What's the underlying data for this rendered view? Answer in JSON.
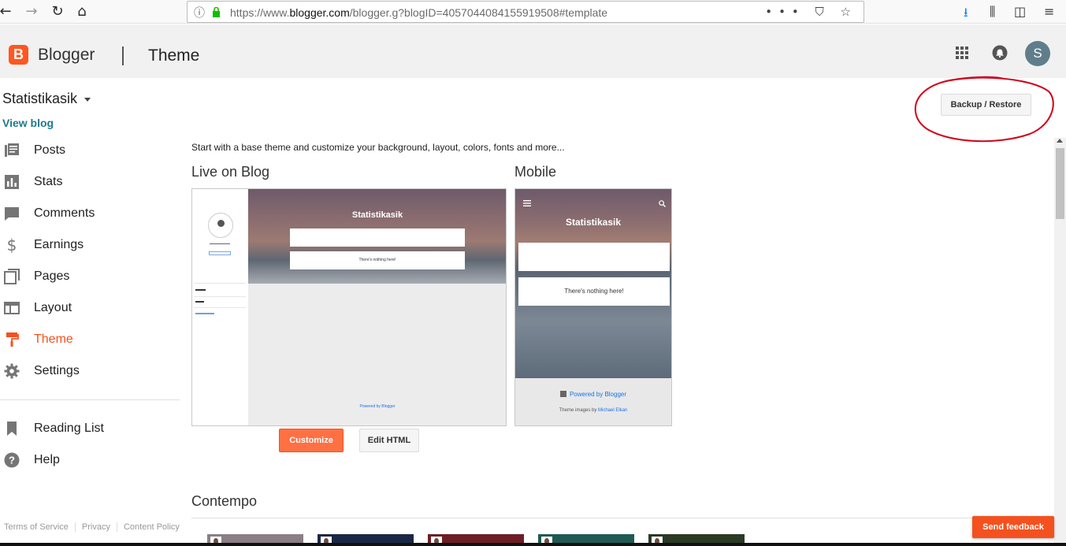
{
  "browser": {
    "url_prefix": "https://www.",
    "url_domain": "blogger.com",
    "url_rest": "/blogger.g?blogID=4057044084155919508#template",
    "page_actions": "••• ⛉ ☆"
  },
  "appbar": {
    "brand": "Blogger",
    "section": "Theme",
    "avatar_letter": "S"
  },
  "sidebar": {
    "blog_name": "Statistikasik",
    "view_blog": "View blog",
    "items": [
      {
        "label": "Posts",
        "icon": "posts-icon"
      },
      {
        "label": "Stats",
        "icon": "stats-icon"
      },
      {
        "label": "Comments",
        "icon": "comments-icon"
      },
      {
        "label": "Earnings",
        "icon": "dollar-icon"
      },
      {
        "label": "Pages",
        "icon": "pages-icon"
      },
      {
        "label": "Layout",
        "icon": "layout-icon"
      },
      {
        "label": "Theme",
        "icon": "paint-roller-icon",
        "active": true
      },
      {
        "label": "Settings",
        "icon": "gear-icon"
      }
    ],
    "secondary_items": [
      {
        "label": "Reading List",
        "icon": "bookmark-icon"
      },
      {
        "label": "Help",
        "icon": "help-icon"
      }
    ],
    "footer_links": [
      "Terms of Service",
      "Privacy",
      "Content Policy"
    ]
  },
  "main": {
    "backup_restore": "Backup / Restore",
    "intro": "Start with a base theme and customize your background, layout, colors, fonts and more...",
    "live_heading": "Live on Blog",
    "mobile_heading": "Mobile",
    "preview": {
      "blog_title": "Statistikasik",
      "nothing_here": "There's nothing here!",
      "powered_by": "Powered by Blogger",
      "theme_credit_prefix": "Theme images by ",
      "theme_credit_author": "Michael Elkan"
    },
    "customize": "Customize",
    "edit_html": "Edit HTML",
    "contempo_heading": "Contempo"
  },
  "feedback": "Send feedback",
  "colors": {
    "accent": "#f4511e",
    "link": "#1f7a8c",
    "annotation": "#d0021b"
  }
}
